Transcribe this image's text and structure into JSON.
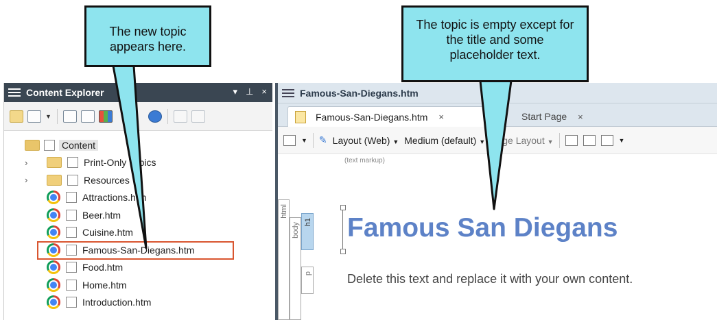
{
  "callouts": [
    {
      "text": "The new topic appears here."
    },
    {
      "text": "The topic is empty except for the title and some placeholder text."
    }
  ],
  "explorer": {
    "title": "Content Explorer",
    "controls": {
      "dropdown": "▾",
      "pin": "⊥",
      "close": "×"
    },
    "tree": {
      "root": "Content",
      "folders": [
        "Print-Only Topics",
        "Resources"
      ],
      "files": [
        "Attractions.htm",
        "Beer.htm",
        "Cuisine.htm",
        "Famous-San-Diegans.htm",
        "Food.htm",
        "Home.htm",
        "Introduction.htm"
      ],
      "selected": "Famous-San-Diegans.htm"
    }
  },
  "editor": {
    "window_title": "Famous-San-Diegans.htm",
    "tabs": [
      {
        "label": "Famous-San-Diegans.htm",
        "active": true
      },
      {
        "label": "Start Page",
        "active": false
      }
    ],
    "toolbar": {
      "layout": "Layout (Web)",
      "medium": "Medium (default)",
      "page_layout": "Page Layout"
    },
    "markup_label": "(text markup)",
    "structure_tags": [
      "html",
      "body",
      "h1",
      "p"
    ],
    "doc_title": "Famous San Diegans",
    "doc_body": "Delete this text and replace it with your own content."
  },
  "colors": {
    "callout_fill": "#8ee4ee",
    "explorer_titlebar": "#3a4652",
    "selection_outline": "#d9552f",
    "heading_color": "#5d82c7"
  }
}
